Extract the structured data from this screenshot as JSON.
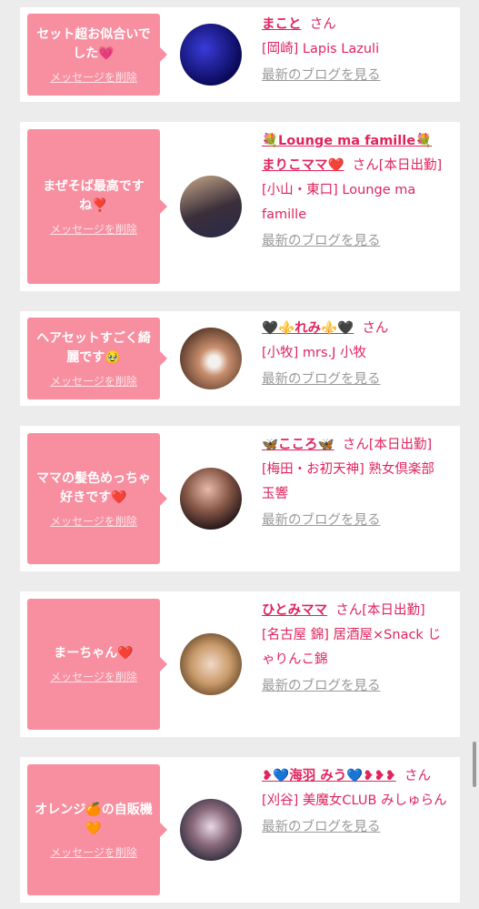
{
  "entries": [
    {
      "message": "セット超お似合いでした💗",
      "delete_label": "メッセージを削除",
      "name": "まこと",
      "san": "さん",
      "shop": "[岡崎] Lapis Lazuli",
      "blog_label": "最新のブログを見る"
    },
    {
      "message": "まぜそば最高ですね❣️",
      "delete_label": "メッセージを削除",
      "name_line1": "💐Lounge ma famille💐",
      "name": "まりこママ❤️",
      "san": "さん[本日出勤]",
      "shop": "[小山・東口] Lounge ma famille",
      "blog_label": "最新のブログを見る"
    },
    {
      "message": "ヘアセットすごく綺麗です🥹",
      "delete_label": "メッセージを削除",
      "name": "🖤⚜️れみ⚜️🖤",
      "san": "さん",
      "shop": "[小牧] mrs.J 小牧",
      "blog_label": "最新のブログを見る"
    },
    {
      "message": "ママの髪色めっちゃ好きです❤️",
      "delete_label": "メッセージを削除",
      "name": "🦋こころ🦋",
      "san": "さん[本日出勤]",
      "shop": "[梅田・お初天神] 熟女倶楽部 玉響",
      "blog_label": "最新のブログを見る"
    },
    {
      "message": "まーちゃん❤️",
      "delete_label": "メッセージを削除",
      "name": "ひとみママ",
      "san": "さん[本日出勤]",
      "shop": "[名古屋 錦] 居酒屋×Snack じゃりんこ錦",
      "blog_label": "最新のブログを見る"
    },
    {
      "message": "オレンジ🍊の自販機🧡",
      "delete_label": "メッセージを削除",
      "name": "❥💙海羽 みう💙❥❥❥",
      "san": "さん",
      "shop": "[刈谷] 美魔女CLUB みしゅらん",
      "blog_label": "最新のブログを見る"
    }
  ],
  "colors": {
    "bubble": "#f78fa0",
    "accent": "#e0245e",
    "muted": "#9a9a9a",
    "background": "#ececec"
  }
}
